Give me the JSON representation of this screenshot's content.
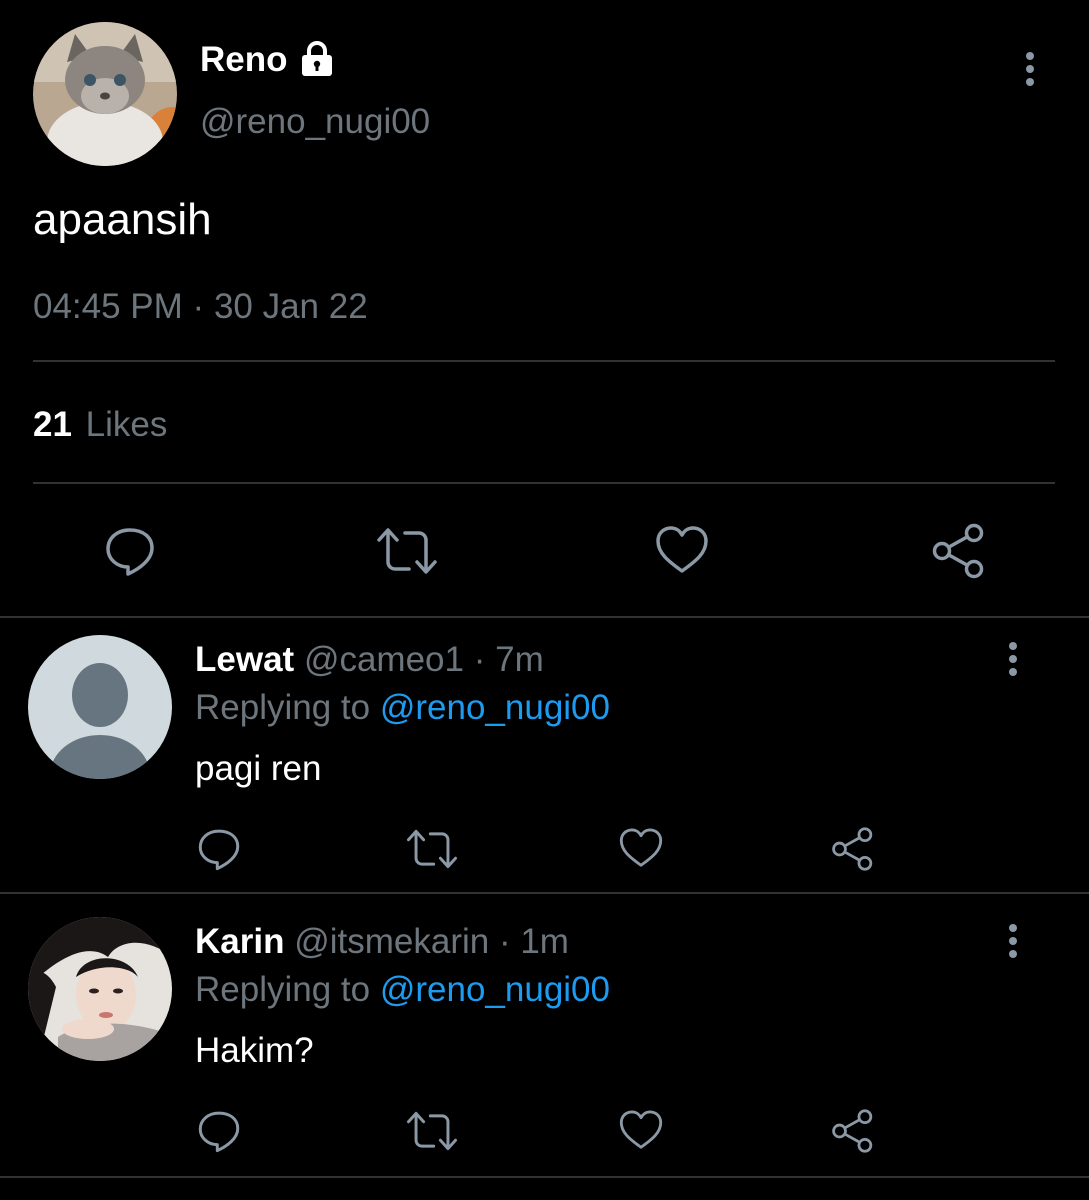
{
  "tweet": {
    "author_name": "Reno",
    "author_handle": "@reno_nugi00",
    "text": "apaansih",
    "time": "04:45 PM",
    "separator": "·",
    "date": "30 Jan 22",
    "likes_count": "21",
    "likes_label": "Likes"
  },
  "replies": [
    {
      "name": "Lewat",
      "handle": "@cameo1",
      "sep": "·",
      "age": "7m",
      "replying_prefix": "Replying to",
      "replying_handle": "@reno_nugi00",
      "text": "pagi ren"
    },
    {
      "name": "Karin",
      "handle": "@itsmekarin",
      "sep": "·",
      "age": "1m",
      "replying_prefix": "Replying to",
      "replying_handle": "@reno_nugi00",
      "text": "Hakim?"
    }
  ],
  "colors": {
    "background": "#000000",
    "text_primary": "#ffffff",
    "text_muted": "#6e767d",
    "accent_link": "#1d9bf0",
    "divider": "#2f3336"
  },
  "icons": [
    "lock-icon",
    "more-vertical-icon",
    "reply-icon",
    "retweet-icon",
    "like-icon",
    "share-icon"
  ]
}
